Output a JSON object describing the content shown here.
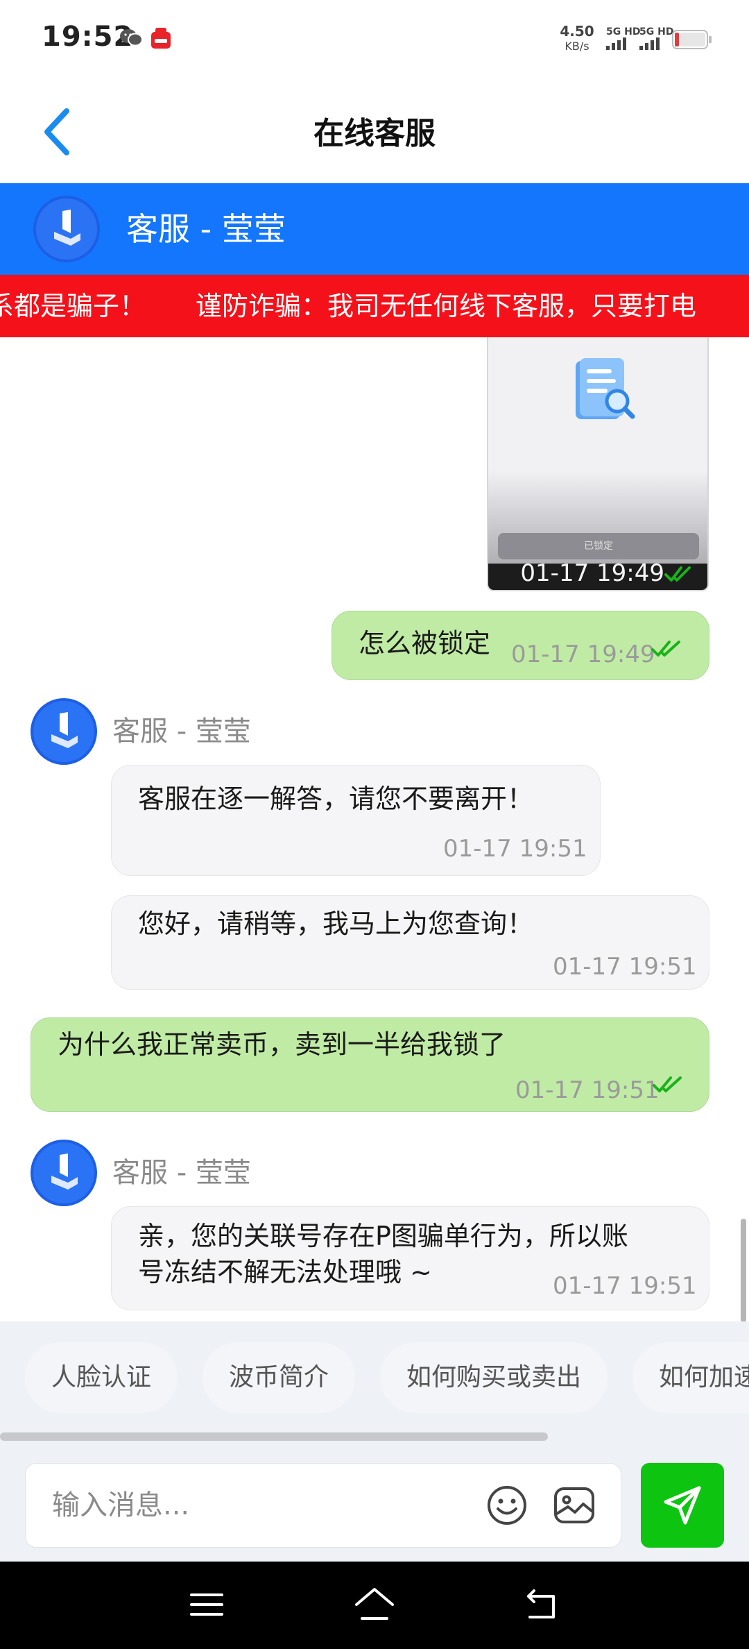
{
  "status_bar": {
    "time": "19:52",
    "net_speed_value": "4.50",
    "net_speed_unit": "KB/s",
    "sim1_label": "5G HD",
    "sim2_label": "5G HD",
    "battery_color": "#e33b3b"
  },
  "header": {
    "title": "在线客服"
  },
  "agent_banner": {
    "name": "客服 - 莹莹",
    "bg_color": "#1476fc"
  },
  "warning": {
    "text_tail": "系都是骗子！",
    "text_full": "谨防诈骗：我司无任何线下客服，只要打电",
    "bg_color": "#f4111a"
  },
  "messages": {
    "image_msg": {
      "locked_label": "已锁定",
      "time": "01-17 19:49"
    },
    "m1": {
      "text": "怎么被锁定",
      "time": "01-17 19:49"
    },
    "sender1": {
      "name": "客服 - 莹莹"
    },
    "m2": {
      "text": "客服在逐一解答，请您不要离开！",
      "time": "01-17 19:51"
    },
    "m3": {
      "text": "您好，请稍等，我马上为您查询！",
      "time": "01-17 19:51"
    },
    "m4": {
      "text": "为什么我正常卖币，卖到一半给我锁了",
      "time": "01-17 19:51"
    },
    "sender2": {
      "name": "客服 - 莹莹"
    },
    "m5": {
      "line1": "亲，您的关联号存在P图骗单行为，所以账",
      "line2": "号冻结不解无法处理哦 ~",
      "time": "01-17 19:51"
    }
  },
  "quick_replies": [
    "人脸认证",
    "波币简介",
    "如何购买或卖出",
    "如何加速"
  ],
  "input": {
    "placeholder": "输入消息...",
    "value": ""
  },
  "colors": {
    "my_bubble": "#c0eba4",
    "agent_bubble": "#f5f5f7",
    "send_button": "#0dc510",
    "read_tick": "#19b21a"
  },
  "icons": {
    "back": "chevron-left-icon",
    "emoji": "smiley-icon",
    "image": "image-icon",
    "send": "send-plane-icon",
    "nav_menu": "menu-icon",
    "nav_home": "home-icon",
    "nav_back": "back-icon"
  }
}
